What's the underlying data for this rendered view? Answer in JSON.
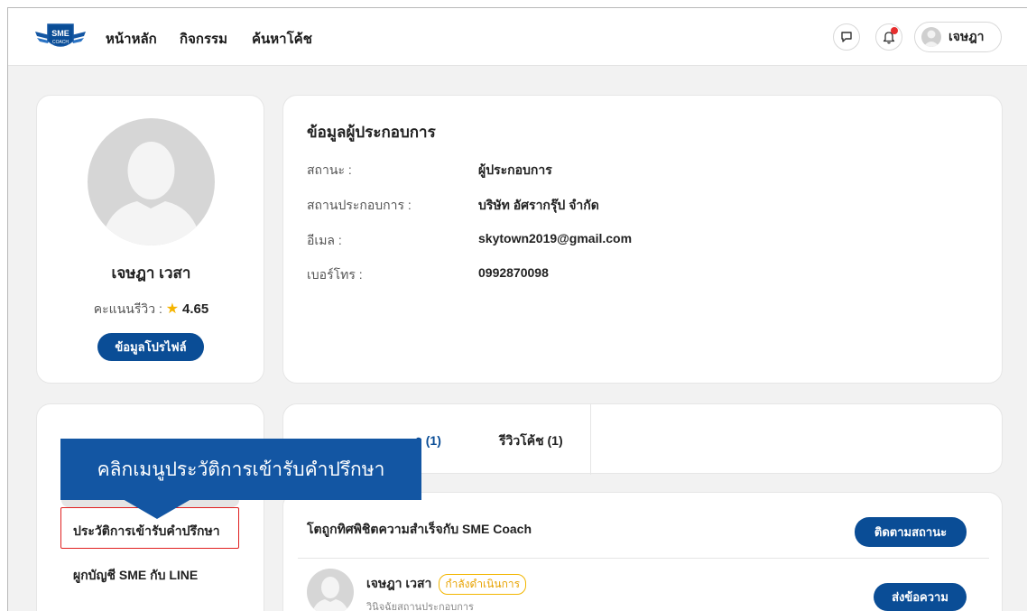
{
  "nav": {
    "brand": "SME COACH",
    "links": [
      "หน้าหลัก",
      "กิจกรรม",
      "ค้นหาโค้ช"
    ],
    "user_name": "เจษฎา"
  },
  "profile": {
    "name": "เจษฎา เวสา",
    "rating_label": "คะแนนรีวิว :",
    "rating_value": "4.65",
    "profile_button": "ข้อมูลโปรไฟล์"
  },
  "info": {
    "title": "ข้อมูลผู้ประกอบการ",
    "rows": [
      {
        "label": "สถานะ :",
        "value": "ผู้ประกอบการ"
      },
      {
        "label": "สถานประกอบการ :",
        "value": "บริษัท อัศรากรุ๊ป จำกัด"
      },
      {
        "label": "อีเมล :",
        "value": "skytown2019@gmail.com"
      },
      {
        "label": "เบอร์โทร :",
        "value": "0992870098"
      }
    ]
  },
  "menu": {
    "items": [
      "ประวัติการเข้ารับคำปรึกษา",
      "ผูกบัญชี SME กับ LINE"
    ]
  },
  "tabs": [
    "ประวัติการเข้ารับคำปรึกษา (1)",
    "รีวิวโค้ช (1)"
  ],
  "tabs_visible": [
    "า (1)",
    "รีวิวโค้ช (1)"
  ],
  "list": {
    "title": "โตถูกทิศพิชิตความสำเร็จกับ SME Coach",
    "follow_button": "ติดตามสถานะ",
    "coach_name": "เจษฎา เวสา",
    "status": "กำลังดำเนินการ",
    "subtitle": "วินิจฉัยสถานประกอบการ",
    "message_button": "ส่งข้อความ"
  },
  "callout": {
    "text": "คลิกเมนูประวัติการเข้ารับคำปรึกษา"
  },
  "colors": {
    "primary": "#0a4d96",
    "callout": "#1356a3",
    "highlight": "#e02020",
    "badge": "#f2b600",
    "notification": "#e62e2e"
  }
}
